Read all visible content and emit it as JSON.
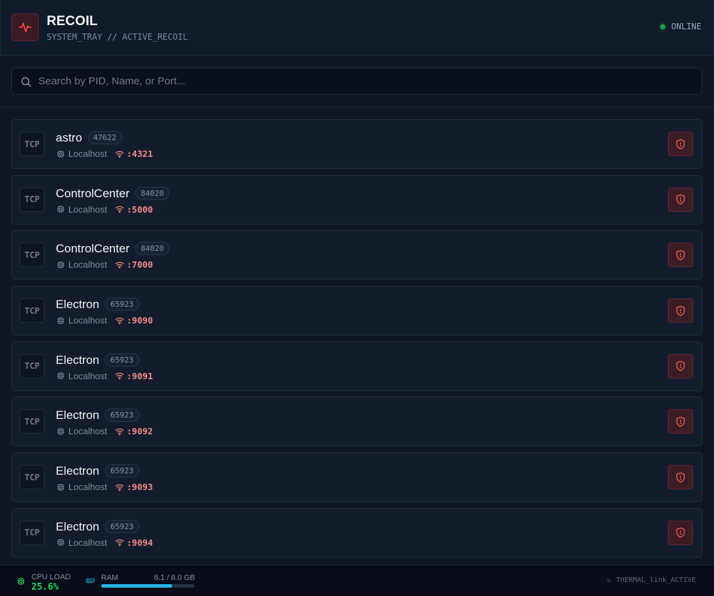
{
  "header": {
    "title": "RECOIL",
    "subtitle": "SYSTEM_TRAY // ACTIVE_RECOIL",
    "status": "ONLINE",
    "logo_icon": "activity-pulse-icon",
    "accent_color": "#ef4444",
    "status_color": "#16a34a"
  },
  "search": {
    "placeholder": "Search by PID, Name, or Port...",
    "value": ""
  },
  "processes": [
    {
      "protocol": "TCP",
      "name": "astro",
      "pid": "47622",
      "host": "Localhost",
      "port": ":4321"
    },
    {
      "protocol": "TCP",
      "name": "ControlCenter",
      "pid": "84020",
      "host": "Localhost",
      "port": ":5000"
    },
    {
      "protocol": "TCP",
      "name": "ControlCenter",
      "pid": "84020",
      "host": "Localhost",
      "port": ":7000"
    },
    {
      "protocol": "TCP",
      "name": "Electron",
      "pid": "65923",
      "host": "Localhost",
      "port": ":9090"
    },
    {
      "protocol": "TCP",
      "name": "Electron",
      "pid": "65923",
      "host": "Localhost",
      "port": ":9091"
    },
    {
      "protocol": "TCP",
      "name": "Electron",
      "pid": "65923",
      "host": "Localhost",
      "port": ":9092"
    },
    {
      "protocol": "TCP",
      "name": "Electron",
      "pid": "65923",
      "host": "Localhost",
      "port": ":9093"
    },
    {
      "protocol": "TCP",
      "name": "Electron",
      "pid": "65923",
      "host": "Localhost",
      "port": ":9094"
    }
  ],
  "footer": {
    "cpu_label": "CPU LOAD",
    "cpu_value": "25.6%",
    "ram_label": "RAM",
    "ram_value": "6.1 / 8.0 GB",
    "ram_fraction": 0.7625,
    "thermal": "THERMAL_link_ACTIVE",
    "cpu_color": "#22d35e",
    "ram_color": "#22b8e6"
  }
}
